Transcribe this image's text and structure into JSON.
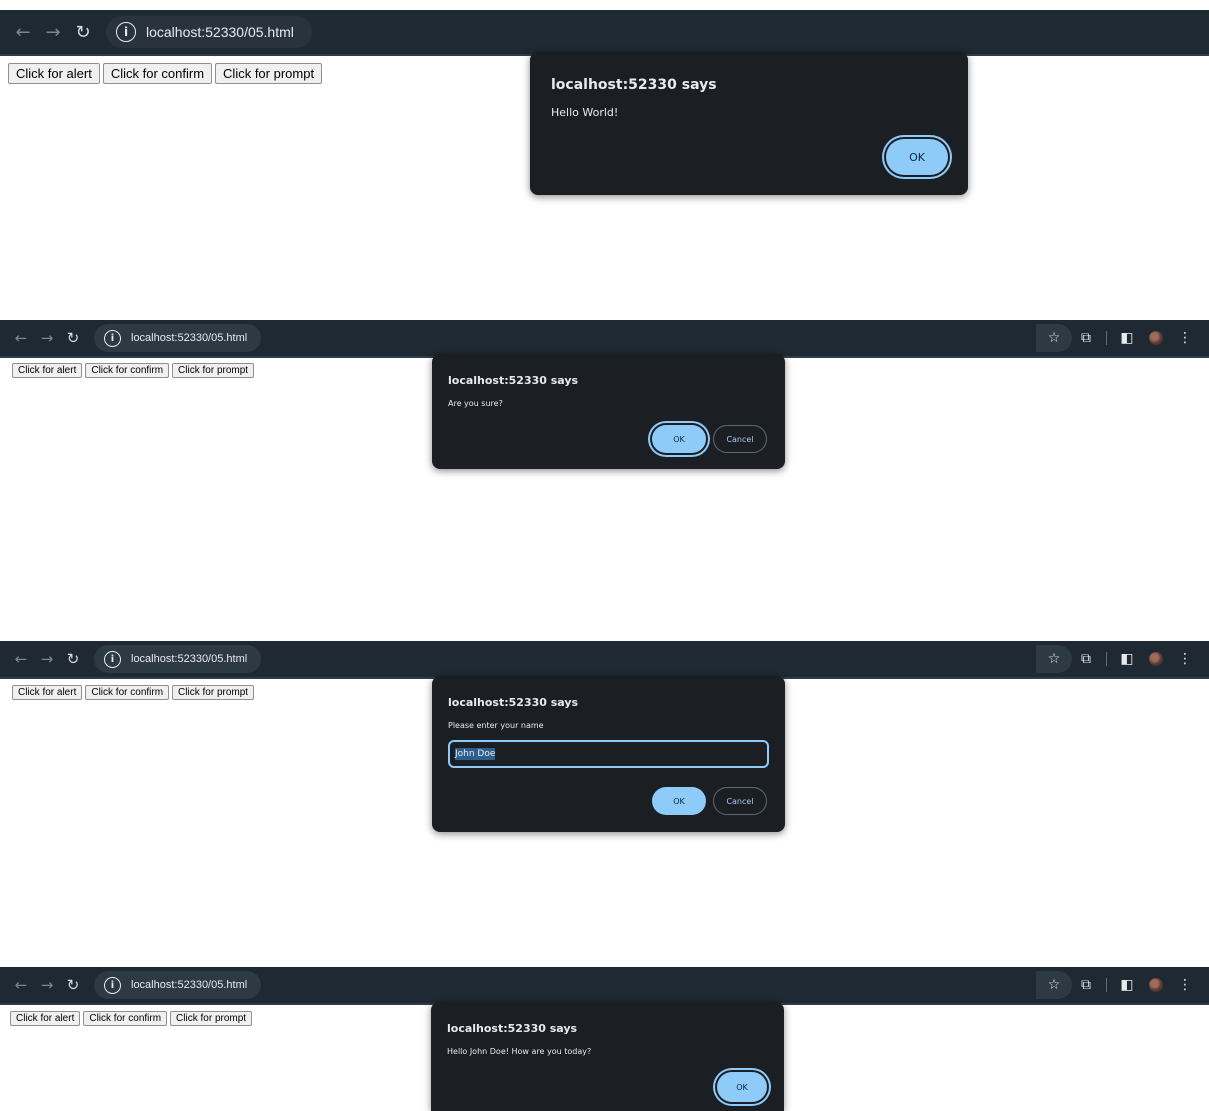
{
  "browser": {
    "url": "localhost:52330/05.html",
    "icons": {
      "back": "back-arrow-icon",
      "forward": "forward-arrow-icon",
      "reload": "reload-icon",
      "info": "info-icon",
      "star": "star-icon",
      "extensions": "puzzle-icon",
      "sidepanel": "side-panel-icon",
      "avatar": "profile-avatar-icon",
      "menu": "kebab-menu-icon"
    }
  },
  "page": {
    "buttons": [
      "Click for alert",
      "Click for confirm",
      "Click for prompt"
    ]
  },
  "panels": [
    {
      "type": "alert",
      "dialog": {
        "title": "localhost:52330 says",
        "message": "Hello World!",
        "ok": "OK"
      }
    },
    {
      "type": "confirm",
      "dialog": {
        "title": "localhost:52330 says",
        "message": "Are you sure?",
        "ok": "OK",
        "cancel": "Cancel"
      }
    },
    {
      "type": "prompt",
      "dialog": {
        "title": "localhost:52330 says",
        "message": "Please enter your name",
        "input_value": "John Doe",
        "ok": "OK",
        "cancel": "Cancel"
      }
    },
    {
      "type": "alert",
      "dialog": {
        "title": "localhost:52330 says",
        "message": "Hello John Doe! How are you today?",
        "ok": "OK"
      }
    }
  ],
  "colors": {
    "toolbar": "#1f2933",
    "dialog": "#1b1f24",
    "accent": "#8ecbf8"
  }
}
